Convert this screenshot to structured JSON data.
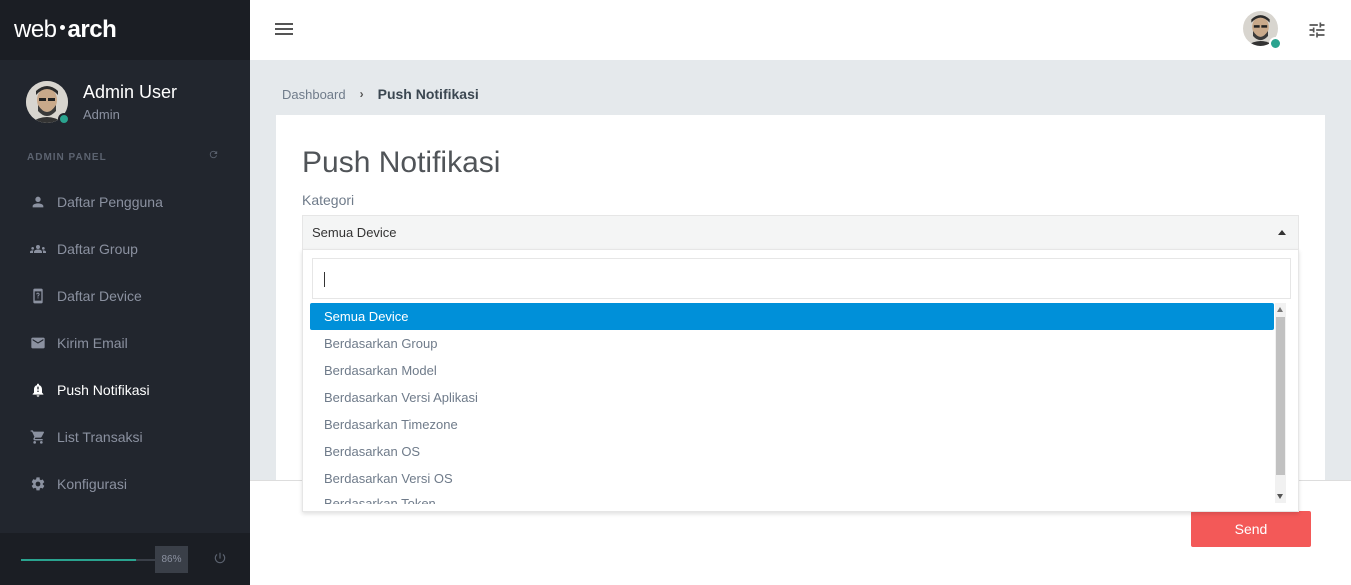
{
  "brand": {
    "part1": "web",
    "part2": "arch"
  },
  "user": {
    "name": "Admin User",
    "role": "Admin"
  },
  "sidebar": {
    "panel_label": "ADMIN PANEL",
    "items": [
      {
        "label": "Daftar Pengguna",
        "icon": "user-icon"
      },
      {
        "label": "Daftar Group",
        "icon": "group-icon"
      },
      {
        "label": "Daftar Device",
        "icon": "device-icon"
      },
      {
        "label": "Kirim Email",
        "icon": "envelope-icon"
      },
      {
        "label": "Push Notifikasi",
        "icon": "bell-icon"
      },
      {
        "label": "List Transaksi",
        "icon": "cart-icon"
      },
      {
        "label": "Konfigurasi",
        "icon": "gear-icon"
      }
    ],
    "active_index": 4,
    "progress": {
      "value": 0.86,
      "label": "86%"
    }
  },
  "breadcrumb": {
    "root": "Dashboard",
    "separator": "›",
    "current": "Push Notifikasi"
  },
  "page": {
    "title": "Push Notifikasi"
  },
  "form": {
    "kategori_label": "Kategori",
    "kategori_value": "Semua Device",
    "search_value": "",
    "options": [
      "Semua Device",
      "Berdasarkan Group",
      "Berdasarkan Model",
      "Berdasarkan Versi Aplikasi",
      "Berdasarkan Timezone",
      "Berdasarkan OS",
      "Berdasarkan Versi OS",
      "Berdasarkan Token"
    ],
    "send_label": "Send"
  },
  "colors": {
    "sidebar_bg": "#22262e",
    "accent_green": "#2aa38f",
    "selected_blue": "#0090d9",
    "send_red": "#f35958"
  }
}
